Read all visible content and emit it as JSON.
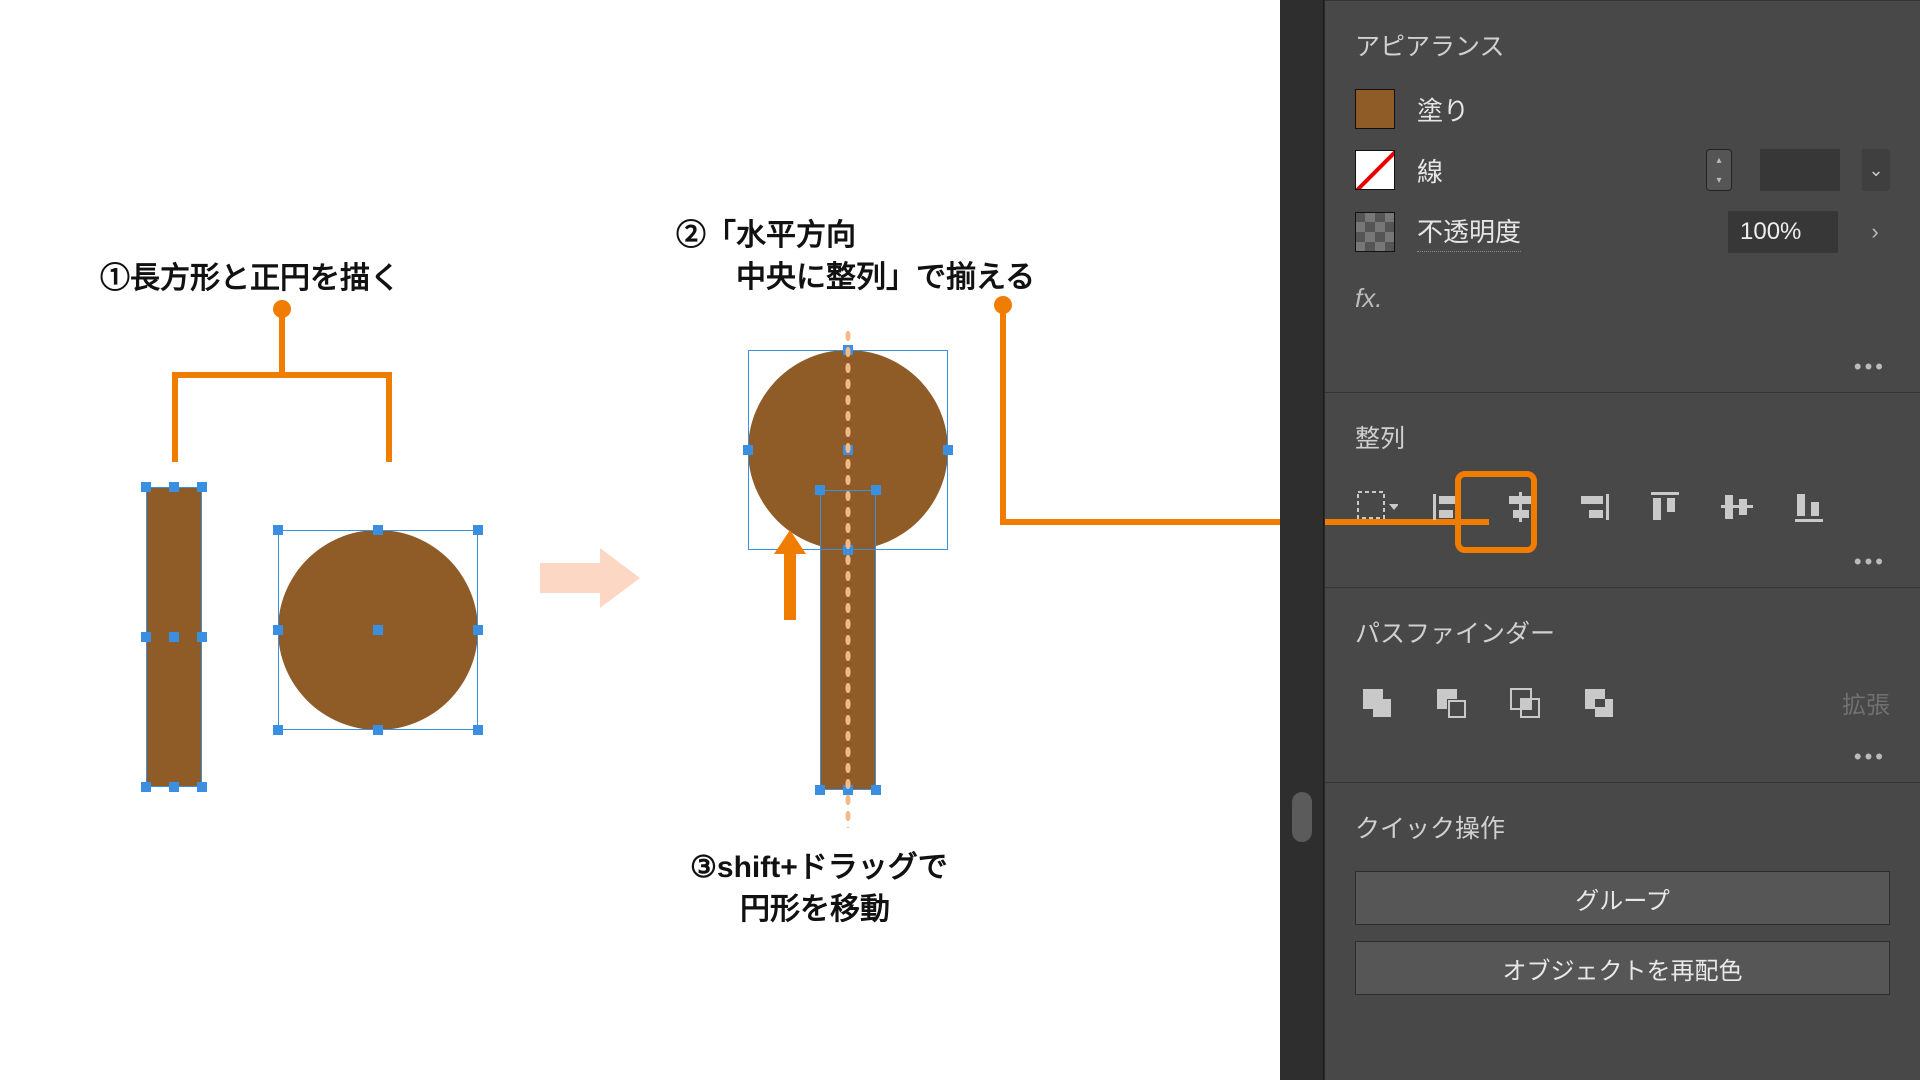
{
  "canvas": {
    "step1": "①長方形と正円を描く",
    "step2a": "②「水平方向",
    "step2b": "　　中央に整列」で揃える",
    "step3a": "③shift+ドラッグで",
    "step3b": "円形を移動"
  },
  "panel": {
    "appearance": {
      "title": "アピアランス",
      "fill_label": "塗り",
      "stroke_label": "線",
      "opacity_label": "不透明度",
      "opacity_value": "100%",
      "fx": "fx.",
      "fill_color": "#8f5b27"
    },
    "align": {
      "title": "整列"
    },
    "pathfinder": {
      "title": "パスファインダー",
      "expand": "拡張"
    },
    "quick": {
      "title": "クイック操作",
      "group": "グループ",
      "recolor": "オブジェクトを再配色"
    }
  },
  "highlight_target": "align-horizontal-center"
}
